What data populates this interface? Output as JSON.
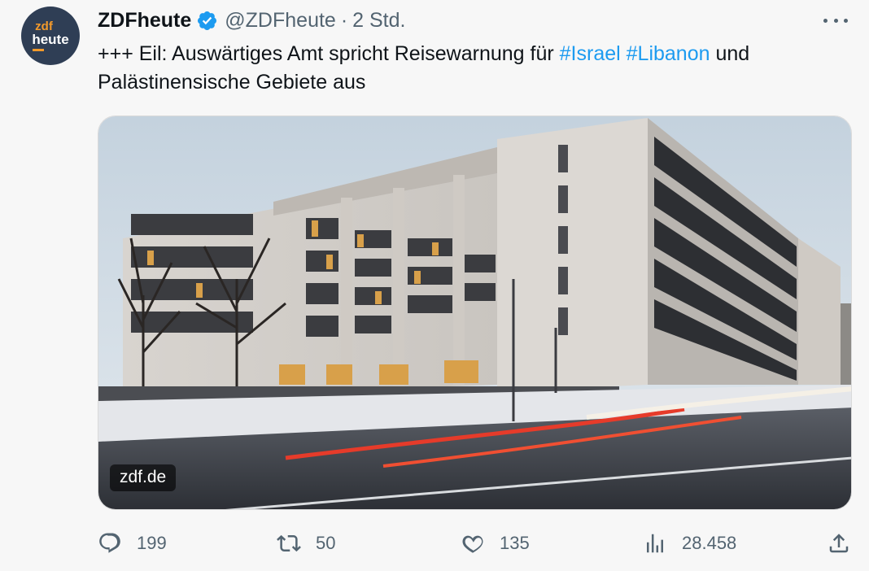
{
  "author": {
    "name": "ZDFheute",
    "handle": "@ZDFheute",
    "separator": "·",
    "time": "2 Std.",
    "verified": true,
    "avatar": {
      "line1": "zdf",
      "line2": "heute"
    }
  },
  "tweet": {
    "text_before": "+++ Eil: Auswärtiges Amt spricht Reisewarnung für ",
    "hashtag1": "#Israel",
    "space": " ",
    "hashtag2": "#Libanon",
    "text_after": " und Palästinensische Gebiete aus"
  },
  "media": {
    "domain_label": "zdf.de"
  },
  "actions": {
    "replies": "199",
    "retweets": "50",
    "likes": "135",
    "views": "28.458"
  },
  "colors": {
    "accent": "#1d9bf0",
    "text": "#0f1419",
    "muted": "#536471",
    "background": "#f7f7f7",
    "avatar_bg": "#2f3e55",
    "avatar_orange": "#f39a2b"
  },
  "icons": {
    "more": "more-dots-icon",
    "verified": "verified-badge-icon",
    "reply": "reply-icon",
    "retweet": "retweet-icon",
    "like": "heart-icon",
    "views": "views-chart-icon",
    "share": "share-icon"
  }
}
